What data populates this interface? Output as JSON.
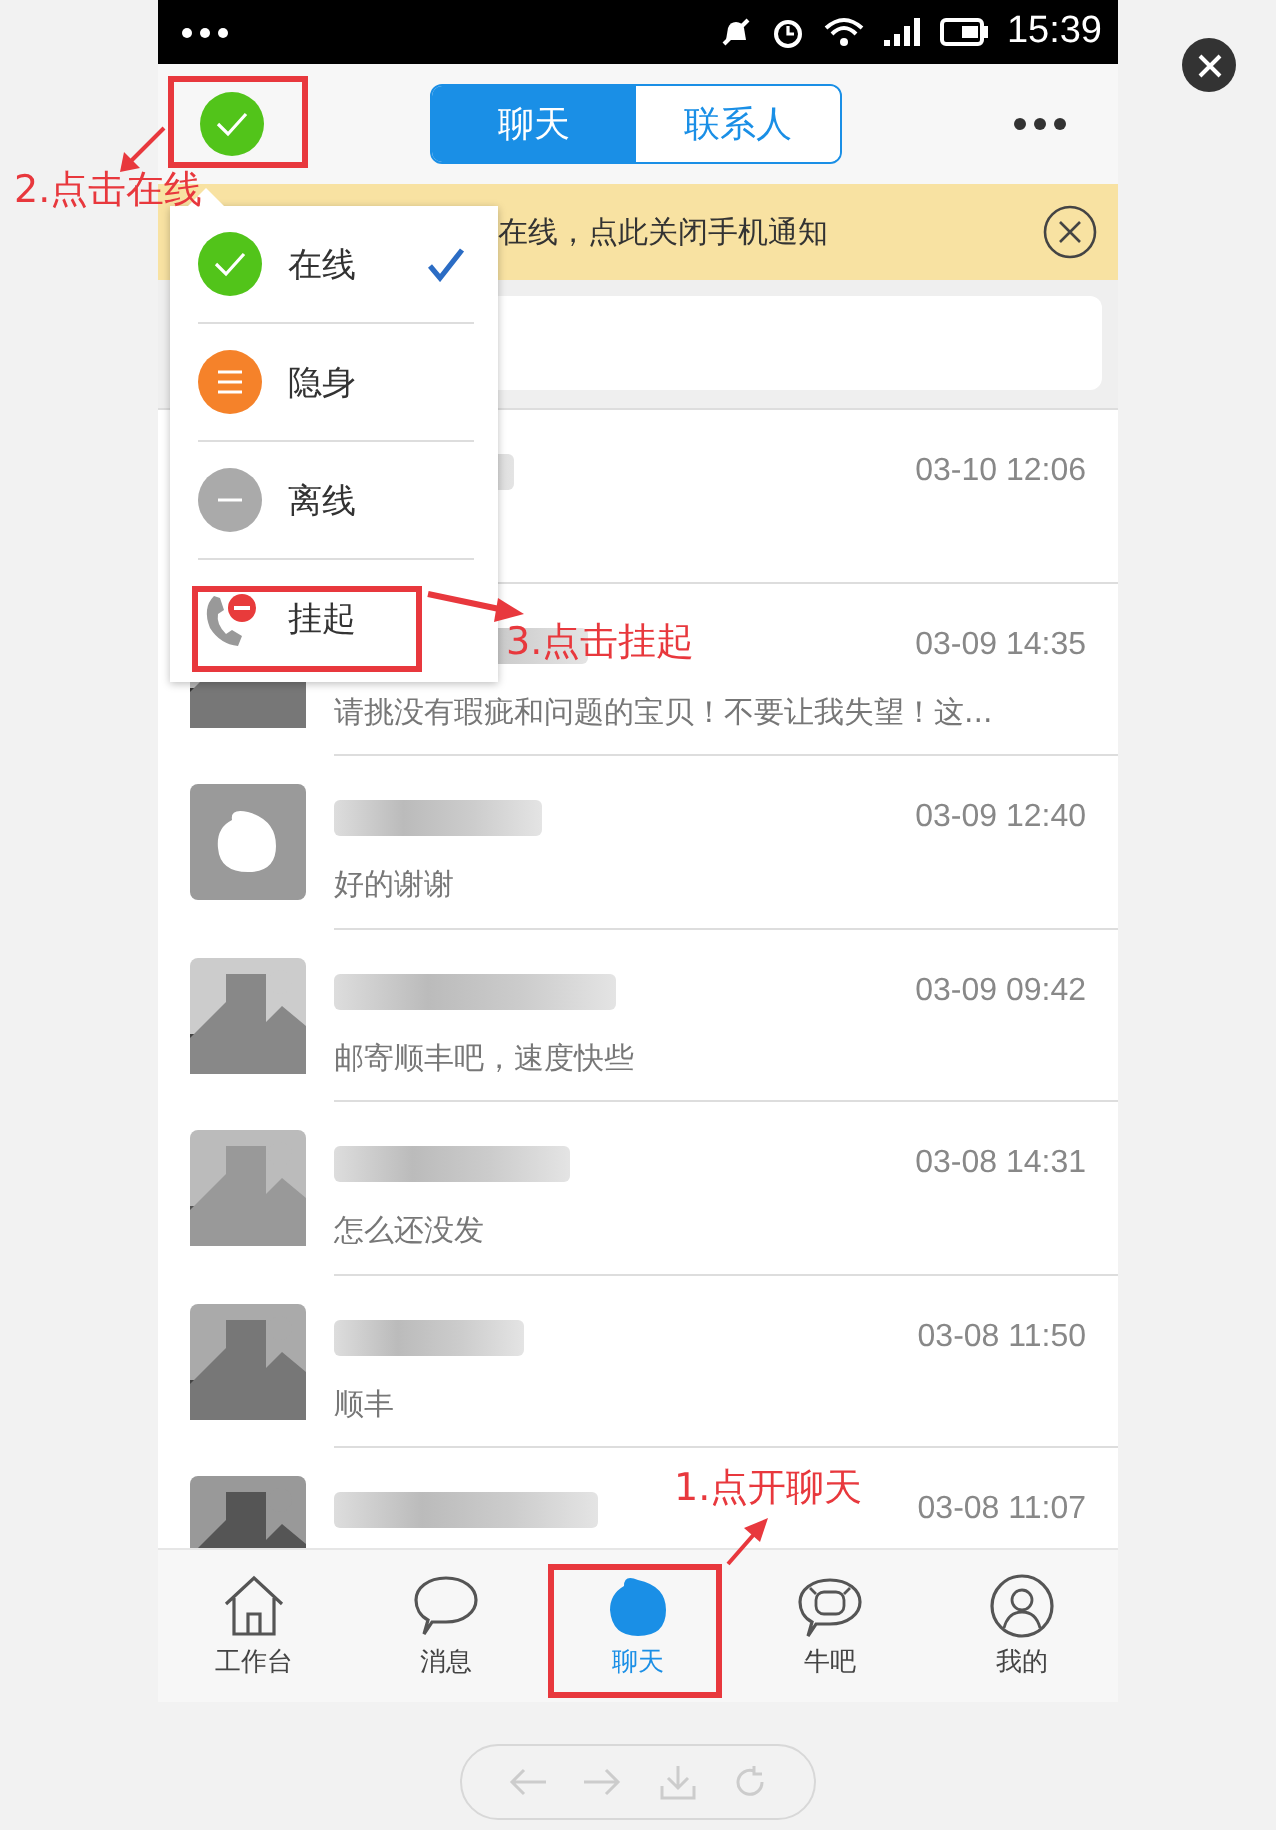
{
  "status_bar": {
    "time": "15:39"
  },
  "header": {
    "tabs": [
      {
        "label": "聊天",
        "selected": true
      },
      {
        "label": "联系人",
        "selected": false
      }
    ]
  },
  "banner": {
    "text": "在线，点此关闭手机通知"
  },
  "status_menu": {
    "items": [
      {
        "label": "在线",
        "kind": "online",
        "selected": true
      },
      {
        "label": "隐身",
        "kind": "invisible",
        "selected": false
      },
      {
        "label": "离线",
        "kind": "offline",
        "selected": false
      },
      {
        "label": "挂起",
        "kind": "hangup",
        "selected": false
      }
    ]
  },
  "conversations": [
    {
      "time": "03-10 12:06",
      "kind": "covered"
    },
    {
      "time": "03-09 14:35",
      "message": "请挑没有瑕疵和问题的宝贝！不要让我失望！这...",
      "kind": "picture"
    },
    {
      "time": "03-09 12:40",
      "message": "好的谢谢",
      "kind": "mascot"
    },
    {
      "time": "03-09 09:42",
      "message": "邮寄顺丰吧，速度快些",
      "kind": "picture"
    },
    {
      "time": "03-08 14:31",
      "message": "怎么还没发",
      "kind": "picture"
    },
    {
      "time": "03-08 11:50",
      "message": "顺丰",
      "kind": "picture"
    },
    {
      "time": "03-08 11:07",
      "kind": "picture"
    }
  ],
  "bottom_nav": [
    {
      "label": "工作台",
      "kind": "home",
      "selected": false
    },
    {
      "label": "消息",
      "kind": "message",
      "selected": false
    },
    {
      "label": "聊天",
      "kind": "chat",
      "selected": true
    },
    {
      "label": "牛吧",
      "kind": "forum",
      "selected": false
    },
    {
      "label": "我的",
      "kind": "profile",
      "selected": false
    }
  ],
  "annotations": [
    {
      "text": "2.点击在线"
    },
    {
      "text": "3.点击挂起"
    },
    {
      "text": "1.点开聊天"
    }
  ]
}
